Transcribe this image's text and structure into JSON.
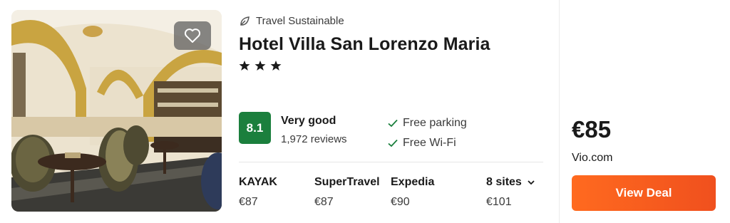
{
  "hotel": {
    "sustainable_label": "Travel Sustainable",
    "name": "Hotel Villa San Lorenzo Maria",
    "star_count": 3
  },
  "rating": {
    "score": "8.1",
    "word": "Very good",
    "reviews": "1,972 reviews",
    "badge_color": "#1b7f3d"
  },
  "amenities": [
    "Free parking",
    "Free Wi-Fi"
  ],
  "providers": [
    {
      "name": "KAYAK",
      "price": "€87"
    },
    {
      "name": "SuperTravel",
      "price": "€87"
    },
    {
      "name": "Expedia",
      "price": "€90"
    }
  ],
  "more_sites": {
    "label": "8 sites",
    "price": "€101"
  },
  "best_deal": {
    "price": "€85",
    "site": "Vio.com",
    "button_label": "View Deal",
    "button_color": "#f35a1f"
  },
  "icons": {
    "favorite": "heart-icon",
    "sustainable": "leaf-icon",
    "star": "star-icon",
    "check": "check-icon",
    "expand": "chevron-down-icon"
  }
}
